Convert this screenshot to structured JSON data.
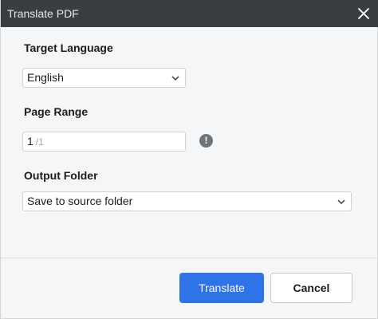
{
  "window": {
    "title": "Translate PDF"
  },
  "target_language": {
    "label": "Target Language",
    "value": "English"
  },
  "page_range": {
    "label": "Page Range",
    "value": "1",
    "total": "/1"
  },
  "output_folder": {
    "label": "Output Folder",
    "value": "Save to source folder"
  },
  "actions": {
    "translate_label": "Translate",
    "cancel_label": "Cancel"
  },
  "colors": {
    "titlebar": "#3a3d41",
    "primary": "#2f73e9",
    "background": "#f5f6f8"
  }
}
